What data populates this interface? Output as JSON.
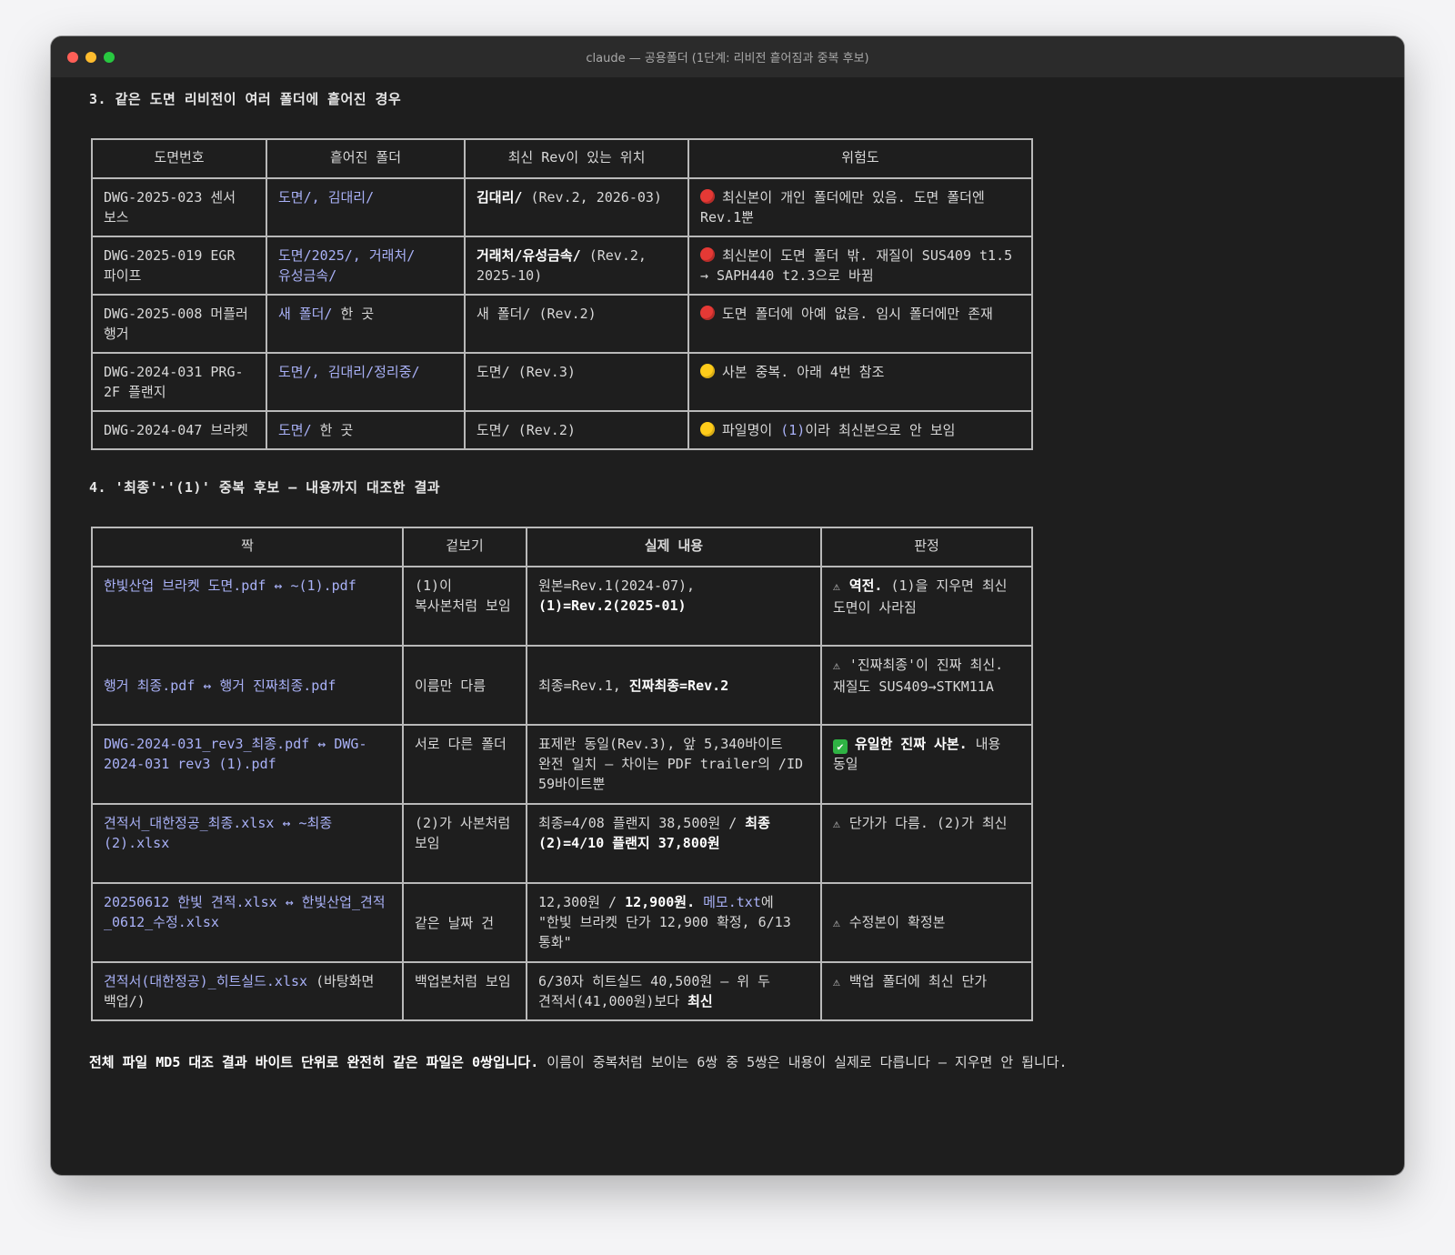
{
  "window": {
    "title": "claude — 공용폴더 (1단계: 리비전 흩어짐과 중복 후보)"
  },
  "section3": {
    "heading": "3. 같은 도면 리비전이 여러 폴더에 흩어진 경우",
    "headers": [
      "도면번호",
      "흩어진 폴더",
      "최신 Rev이 있는 위치",
      "위험도"
    ],
    "rows": [
      {
        "dwg": "DWG-2025-023 센서 보스",
        "folders": "도면/, 김대리/",
        "loc_bold": "김대리/",
        "loc_rest": " (Rev.2, 2026-03)",
        "risk_level": "red",
        "risk": "최신본이 개인 폴더에만 있음. 도면 폴더엔 Rev.1뿐"
      },
      {
        "dwg": "DWG-2025-019 EGR 파이프",
        "folders": "도면/2025/, 거래처/유성금속/",
        "loc_bold": "거래처/유성금속/",
        "loc_rest": " (Rev.2, 2025-10)",
        "risk_level": "red",
        "risk": "최신본이 도면 폴더 밖. 재질이 SUS409 t1.5 → SAPH440 t2.3으로 바뀜"
      },
      {
        "dwg": "DWG-2025-008 머플러 행거",
        "folders_link": "새 폴더/",
        "folders_rest": " 한 곳",
        "loc_bold": "",
        "loc_rest": "새 폴더/ (Rev.2)",
        "risk_level": "red",
        "risk": "도면 폴더에 아예 없음. 임시 폴더에만 존재"
      },
      {
        "dwg": "DWG-2024-031 PRG-2F 플랜지",
        "folders": "도면/, 김대리/정리중/",
        "loc_bold": "",
        "loc_rest": "도면/ (Rev.3)",
        "risk_level": "yellow",
        "risk": "사본 중복. 아래 4번 참조"
      },
      {
        "dwg": "DWG-2024-047 브라켓",
        "folders_link": "도면/",
        "folders_rest": " 한 곳",
        "loc_bold": "",
        "loc_rest": "도면/ (Rev.2)",
        "risk_level": "yellow",
        "risk_pre": "파일명이 ",
        "risk_link": "(1)",
        "risk_post": "이라 최신본으로 안 보임"
      }
    ]
  },
  "section4": {
    "heading": "4. '최종'·'(1)' 중복 후보 — 내용까지 대조한 결과",
    "headers": [
      "짝",
      "겉보기",
      "실제 내용",
      "판정"
    ],
    "rows": [
      {
        "pair": "한빛산업 브라켓 도면.pdf ↔ ~(1).pdf",
        "looks": "(1)이 복사본처럼 보임",
        "content_plain": "원본=Rev.1(2024-07), ",
        "content_bold": "(1)=Rev.2(2025-01)",
        "verdict_icon": "⚠",
        "verdict_bold": "역전.",
        "verdict_rest": " (1)을 지우면 최신 도면이 사라짐"
      },
      {
        "pair": "행거 최종.pdf ↔ 행거 진짜최종.pdf",
        "looks": "이름만 다름",
        "content_plain": "최종=Rev.1, ",
        "content_bold": "진짜최종=Rev.2",
        "verdict_icon": "⚠",
        "verdict_bold": "",
        "verdict_rest": "'진짜최종'이 진짜 최신. 재질도 SUS409→STKM11A"
      },
      {
        "pair": "DWG-2024-031_rev3_최종.pdf ↔ DWG-2024-031 rev3 (1).pdf",
        "looks": "서로 다른 폴더",
        "content_plain": "표제란 동일(Rev.3), 앞 5,340바이트 완전 일치 — 차이는 PDF trailer의 /ID 59바이트뿐",
        "content_bold": "",
        "verdict_icon": "✔",
        "verdict_bold": "유일한 진짜 사본.",
        "verdict_rest": " 내용 동일"
      },
      {
        "pair": "견적서_대한정공_최종.xlsx ↔ ~최종(2).xlsx",
        "looks": "(2)가 사본처럼 보임",
        "content_plain": "최종=4/08 플랜지 38,500원 / ",
        "content_bold": "최종(2)=4/10 플랜지 37,800원",
        "verdict_icon": "⚠",
        "verdict_bold": "",
        "verdict_rest": "단가가 다름. (2)가 최신"
      },
      {
        "pair": "20250612 한빛 견적.xlsx ↔ 한빛산업_견적_0612_수정.xlsx",
        "looks": "같은 날짜 건",
        "content_a": "12,300원 / ",
        "content_b": "12,900원.",
        "content_link": "메모.txt",
        "content_c": "에 \"한빛 브라켓 단가 12,900 확정, 6/13 통화\"",
        "verdict_icon": "⚠",
        "verdict_bold": "",
        "verdict_rest": "수정본이 확정본"
      },
      {
        "pair_link": "견적서(대한정공)_히트실드.xlsx",
        "pair_rest": " (바탕화면 백업/)",
        "looks": "백업본처럼 보임",
        "content_plain": "6/30자 히트실드 40,500원 — 위 두 견적서(41,000원)보다 ",
        "content_bold": "최신",
        "verdict_icon": "⚠",
        "verdict_bold": "",
        "verdict_rest": "백업 폴더에 최신 단가"
      }
    ]
  },
  "summary": {
    "bold": "전체 파일 MD5 대조 결과 바이트 단위로 완전히 같은 파일은 0쌍입니다.",
    "rest": " 이름이 중복처럼 보이는 6쌍 중 5쌍은 내용이 실제로 다릅니다 — 지우면 안 됩니다."
  }
}
